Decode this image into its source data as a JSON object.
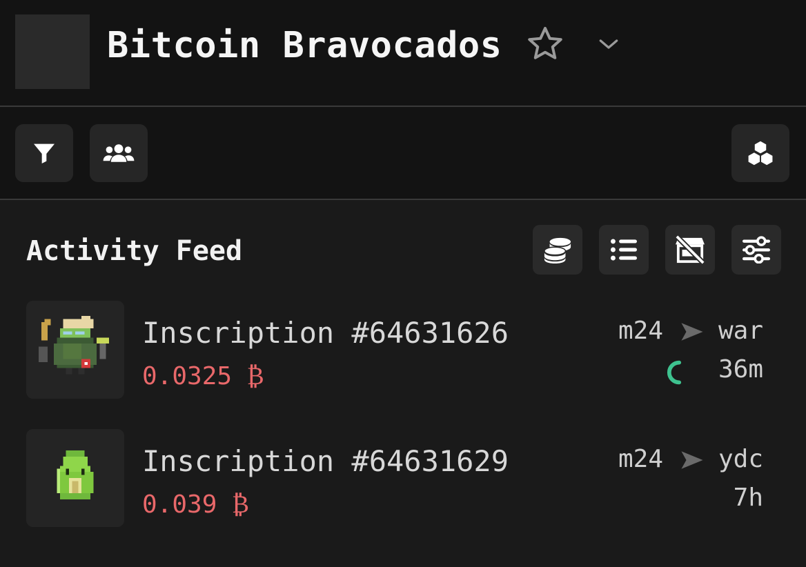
{
  "header": {
    "title": "Bitcoin Bravocados",
    "icons": [
      "star-icon",
      "chevron-down-icon"
    ]
  },
  "toolbar": {
    "icons": [
      "filter-icon",
      "users-icon",
      "cubes-icon"
    ]
  },
  "feed": {
    "title": "Activity Feed",
    "icons": [
      "coins-icon",
      "list-icon",
      "store-slash-icon",
      "sliders-icon"
    ],
    "items": [
      {
        "name": "Inscription #64631626",
        "price": "0.0325 ₿",
        "from": "m24",
        "to": "war",
        "time": "36m",
        "pending": true
      },
      {
        "name": "Inscription #64631629",
        "price": "0.039 ₿",
        "from": "m24",
        "to": "ydc",
        "time": "7h",
        "pending": false
      }
    ]
  },
  "colors": {
    "background": "#141414",
    "panel": "#1a1a1a",
    "button": "#262626",
    "price": "#e9686a",
    "pending": "#3ec28f"
  }
}
